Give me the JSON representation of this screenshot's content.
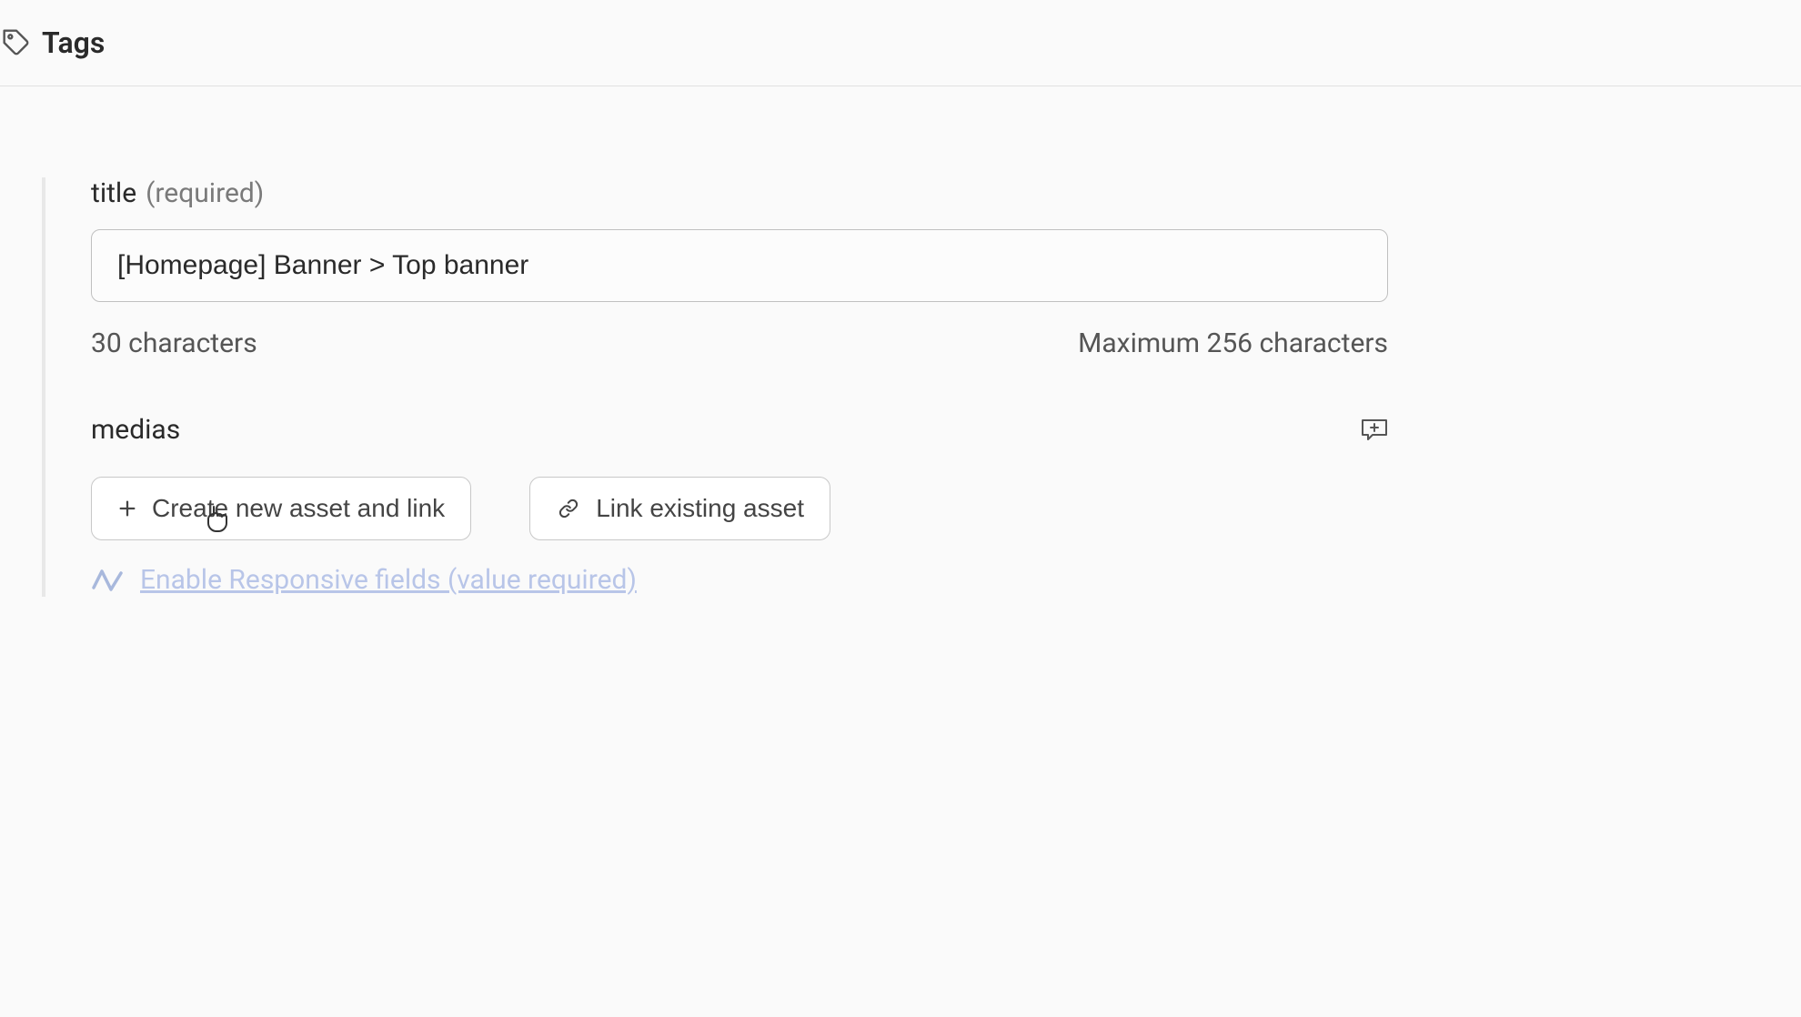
{
  "header": {
    "title": "Tags"
  },
  "title_field": {
    "label": "title",
    "required_label": "(required)",
    "value": "[Homepage] Banner > Top banner",
    "char_count": "30 characters",
    "max_chars": "Maximum 256 characters"
  },
  "medias_field": {
    "label": "medias",
    "create_button": "Create new asset and link",
    "link_button": "Link existing asset",
    "responsive_link": "Enable Responsive fields (value required)"
  }
}
